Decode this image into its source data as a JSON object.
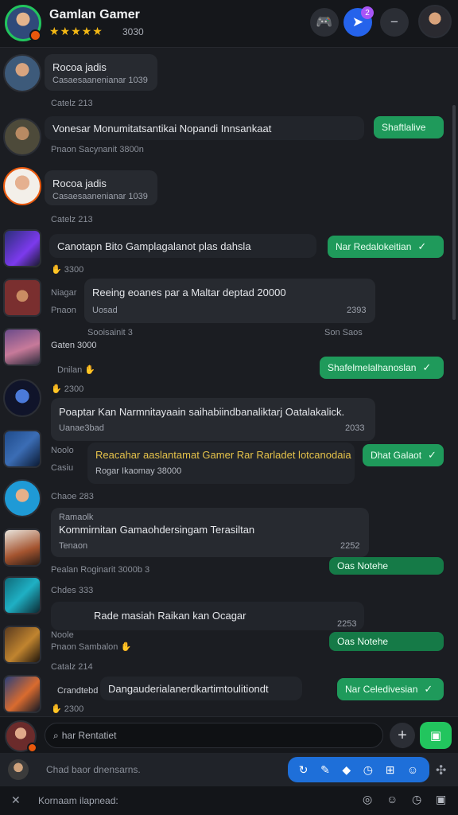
{
  "header": {
    "title": "Gamlan Gamer",
    "stars": "★★★★★",
    "subtitle": "3030",
    "notification_count": "2"
  },
  "feed": [
    {
      "kind": "post",
      "title": "Rocoa jadis",
      "sub": "Casaesaanenianar 1039",
      "below": "Catelz 213"
    },
    {
      "kind": "wide",
      "title": "Vonesar Monumitatsantikai Nopandi Innsankaat",
      "meta": "Pnaon Sacynanit 3800n",
      "button": "Shaftlalive"
    },
    {
      "kind": "post",
      "title": "Rocoa jadis",
      "sub": "Casaesaanenianar 1039",
      "below": "Catelz 213"
    },
    {
      "kind": "wide",
      "title": "Canotapn Bito Gamplagalanot plas dahsla",
      "meta": "3300",
      "button": "Nar Redalokeitian"
    },
    {
      "kind": "msg",
      "left1": "Niagar",
      "left2": "Pnaon",
      "title": "Reeing eoanes par a Maltar deptad 20000",
      "sub": "Uosad",
      "time": "2393",
      "footL": "Sooisainit 3",
      "footR": "Son Saos"
    },
    {
      "kind": "simple",
      "left": "Gaten 3000",
      "meta": "Dnilan"
    },
    {
      "kind": "button-only",
      "button": "Shafelmelalhanoslan"
    },
    {
      "kind": "wide2",
      "meta": "2300",
      "title": "Poaptar Kan Narmnitayaain saihabiindbanaliktarj Oatalakalick.",
      "sub": "Uanae3bad",
      "time": "2033"
    },
    {
      "kind": "yellow",
      "left1": "Noolo",
      "left2": "Casiu",
      "title": "Reacahar aaslantamat Gamer Rar Rarladet lotcanodaia",
      "sub": "Rogar Ikaomay 38000",
      "button": "Dhat Galaot"
    },
    {
      "kind": "simple",
      "left": "Chaoe 283"
    },
    {
      "kind": "post2",
      "sub0": "Ramaolk",
      "title": "Kommirnitan Gamaohdersingam Terasiltan",
      "sub": "Tenaon",
      "time": "2252",
      "foot": "Pealan Roginarit 3000b 3",
      "button": "Oas Notehe"
    },
    {
      "kind": "simple",
      "left": "Chdes 333"
    },
    {
      "kind": "msg2",
      "title": "Rade masiah Raikan kan Ocagar",
      "time": "2253"
    },
    {
      "kind": "simple2",
      "left1": "Noole",
      "left2": "Pnaon Sambalon",
      "button": "Oas Notehe"
    },
    {
      "kind": "simple",
      "left": "Catalz 214"
    },
    {
      "kind": "wide3",
      "left": "Crandtebd",
      "title": "Dangauderialanerdkartimtoulitiondt",
      "button": "Nar Celedivesian",
      "meta": "2300"
    }
  ],
  "composer": {
    "placeholder": "har Rentatiet"
  },
  "toolbar": {
    "hint": "Chad baor dnensarns."
  },
  "bottom": {
    "hint": "Kornaam ilapnead:"
  },
  "colors": {
    "accent_green": "#1f9a5b",
    "accent_blue": "#1e6fd9",
    "star": "#f5b915"
  },
  "icons": [
    "game-controller-icon",
    "send-icon",
    "more-icon",
    "search-icon",
    "plus-icon",
    "send-box-icon",
    "attach-icon",
    "emoji-icon",
    "close-icon"
  ]
}
